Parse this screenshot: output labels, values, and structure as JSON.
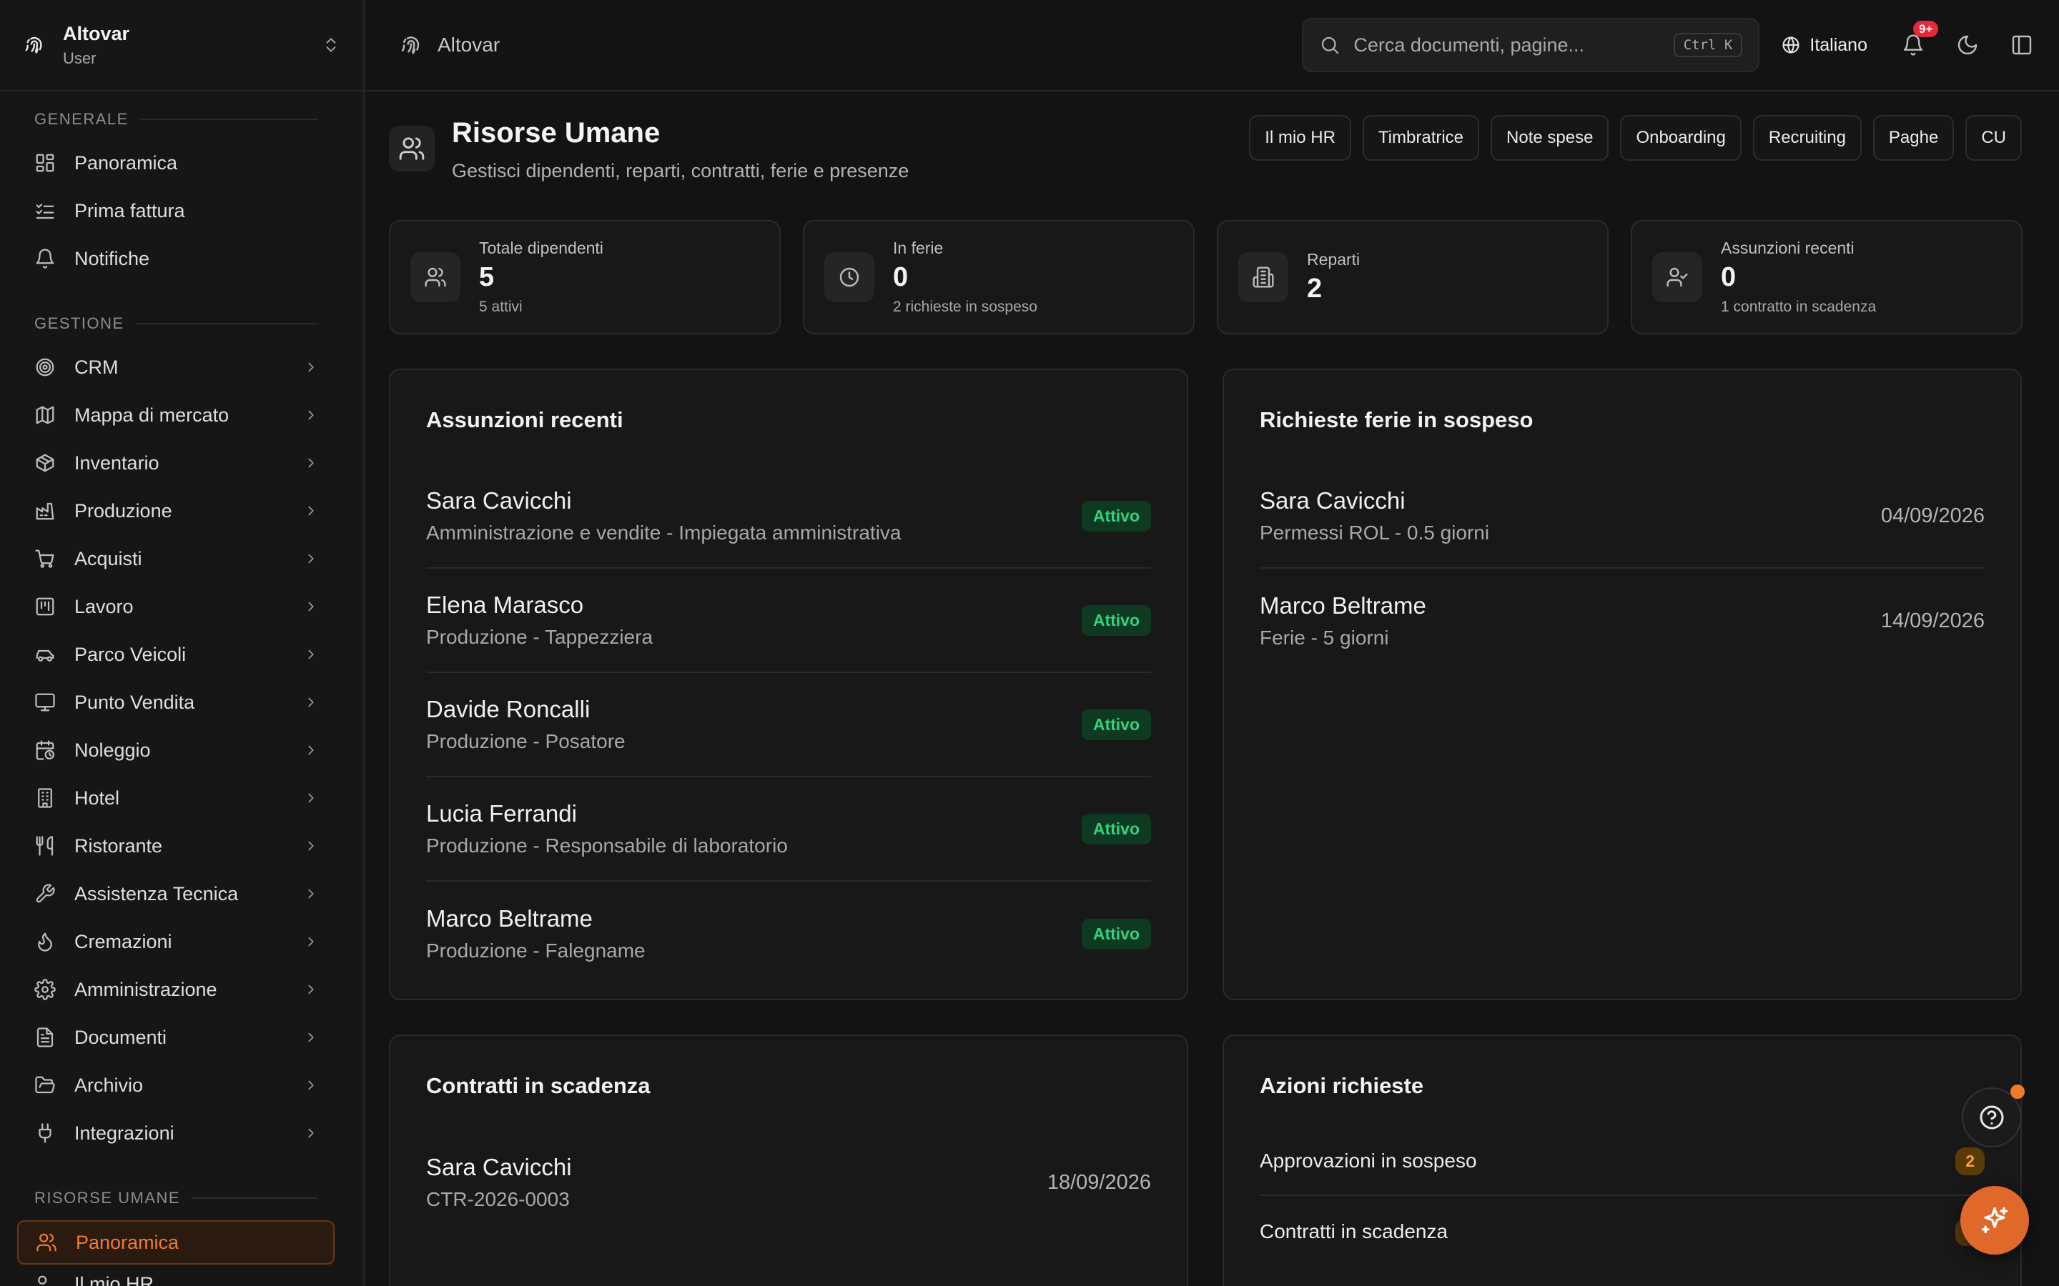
{
  "org": {
    "name": "Altovar",
    "role": "User"
  },
  "sidebar": {
    "groups": [
      {
        "title": "GENERALE",
        "items": [
          {
            "label": "Panoramica",
            "icon": "dashboard-icon"
          },
          {
            "label": "Prima fattura",
            "icon": "checklist-icon"
          },
          {
            "label": "Notifiche",
            "icon": "bell-icon"
          }
        ]
      },
      {
        "title": "GESTIONE",
        "items": [
          {
            "label": "CRM",
            "icon": "target-icon"
          },
          {
            "label": "Mappa di mercato",
            "icon": "map-icon"
          },
          {
            "label": "Inventario",
            "icon": "package-icon"
          },
          {
            "label": "Produzione",
            "icon": "factory-icon"
          },
          {
            "label": "Acquisti",
            "icon": "cart-icon"
          },
          {
            "label": "Lavoro",
            "icon": "kanban-icon"
          },
          {
            "label": "Parco Veicoli",
            "icon": "car-icon"
          },
          {
            "label": "Punto Vendita",
            "icon": "monitor-icon"
          },
          {
            "label": "Noleggio",
            "icon": "calendar-clock-icon"
          },
          {
            "label": "Hotel",
            "icon": "hotel-icon"
          },
          {
            "label": "Ristorante",
            "icon": "utensils-icon"
          },
          {
            "label": "Assistenza Tecnica",
            "icon": "wrench-icon"
          },
          {
            "label": "Cremazioni",
            "icon": "flame-icon"
          },
          {
            "label": "Amministrazione",
            "icon": "gear-icon"
          },
          {
            "label": "Documenti",
            "icon": "document-icon"
          },
          {
            "label": "Archivio",
            "icon": "folder-open-icon"
          },
          {
            "label": "Integrazioni",
            "icon": "plug-icon"
          }
        ]
      },
      {
        "title": "RISORSE UMANE",
        "items": [
          {
            "label": "Panoramica",
            "icon": "users-icon",
            "active": true
          },
          {
            "label": "Il mio HR",
            "icon": "users-icon"
          }
        ]
      }
    ]
  },
  "topbar": {
    "app_name": "Altovar",
    "search_placeholder": "Cerca documenti, pagine...",
    "search_shortcut": "Ctrl K",
    "language": "Italiano",
    "notifications_badge": "9+"
  },
  "page": {
    "title": "Risorse Umane",
    "subtitle": "Gestisci dipendenti, reparti, contratti, ferie e presenze",
    "quick_links": [
      "Il mio HR",
      "Timbratrice",
      "Note spese",
      "Onboarding",
      "Recruiting",
      "Paghe",
      "CU"
    ]
  },
  "stats": [
    {
      "label": "Totale dipendenti",
      "value": "5",
      "sub": "5 attivi",
      "icon": "users-icon"
    },
    {
      "label": "In ferie",
      "value": "0",
      "sub": "2 richieste in sospeso",
      "icon": "clock-icon"
    },
    {
      "label": "Reparti",
      "value": "2",
      "sub": "",
      "icon": "building-icon"
    },
    {
      "label": "Assunzioni recenti",
      "value": "0",
      "sub": "1 contratto in scadenza",
      "icon": "user-check-icon"
    }
  ],
  "recent_hires": {
    "title": "Assunzioni recenti",
    "rows": [
      {
        "name": "Sara Cavicchi",
        "detail": "Amministrazione e vendite - Impiegata amministrativa",
        "status": "Attivo"
      },
      {
        "name": "Elena Marasco",
        "detail": "Produzione - Tappezziera",
        "status": "Attivo"
      },
      {
        "name": "Davide Roncalli",
        "detail": "Produzione - Posatore",
        "status": "Attivo"
      },
      {
        "name": "Lucia Ferrandi",
        "detail": "Produzione - Responsabile di laboratorio",
        "status": "Attivo"
      },
      {
        "name": "Marco Beltrame",
        "detail": "Produzione - Falegname",
        "status": "Attivo"
      }
    ]
  },
  "leave_requests": {
    "title": "Richieste ferie in sospeso",
    "rows": [
      {
        "name": "Sara Cavicchi",
        "detail": "Permessi ROL - 0.5 giorni",
        "date": "04/09/2026"
      },
      {
        "name": "Marco Beltrame",
        "detail": "Ferie - 5 giorni",
        "date": "14/09/2026"
      }
    ]
  },
  "expiring_contracts": {
    "title": "Contratti in scadenza",
    "rows": [
      {
        "name": "Sara Cavicchi",
        "detail": "CTR-2026-0003",
        "date": "18/09/2026"
      }
    ]
  },
  "required_actions": {
    "title": "Azioni richieste",
    "rows": [
      {
        "label": "Approvazioni in sospeso",
        "count": "2"
      },
      {
        "label": "Contratti in scadenza",
        "count": "1"
      }
    ]
  },
  "colors": {
    "accent": "#f07a2c",
    "success": "#35d07f",
    "warning": "#f2a33a",
    "danger": "#e5283c"
  }
}
